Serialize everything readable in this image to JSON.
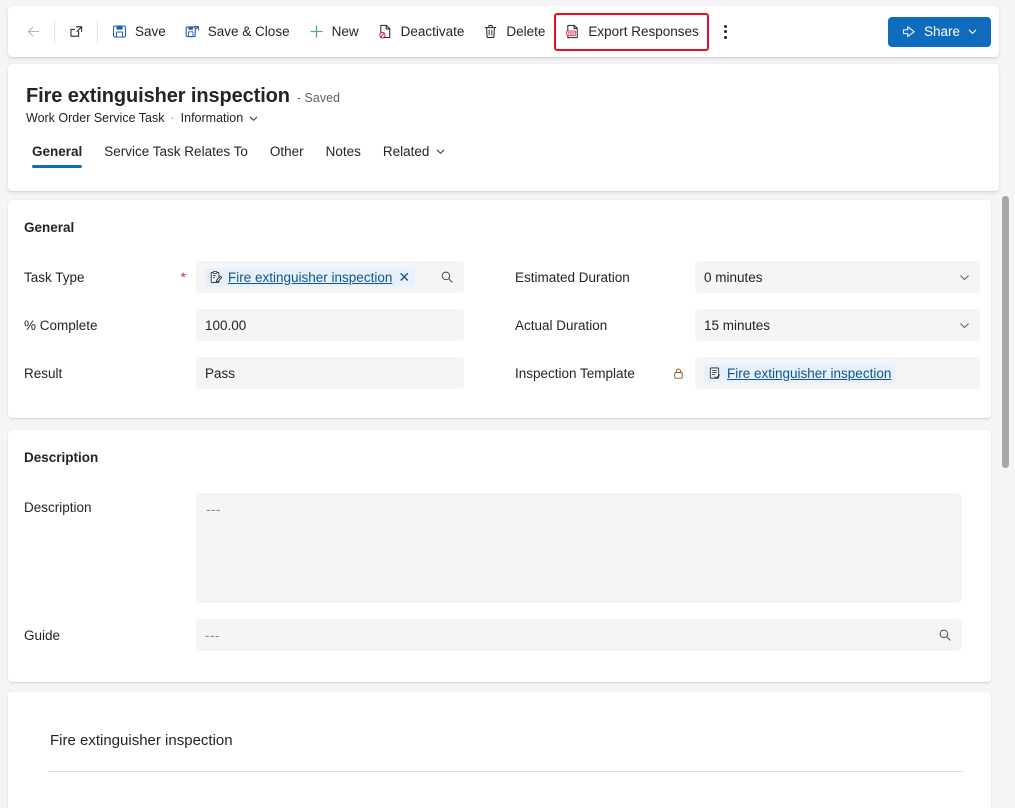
{
  "commandbar": {
    "back_label": "Back",
    "popout_label": "Open in new window",
    "buttons": [
      {
        "id": "save",
        "label": "Save",
        "icon": "save-icon"
      },
      {
        "id": "save-close",
        "label": "Save & Close",
        "icon": "save-and-close-icon"
      },
      {
        "id": "new",
        "label": "New",
        "icon": "plus-icon"
      },
      {
        "id": "deactivate",
        "label": "Deactivate",
        "icon": "deactivate-icon"
      },
      {
        "id": "delete",
        "label": "Delete",
        "icon": "trash-icon"
      },
      {
        "id": "export-responses",
        "label": "Export Responses",
        "icon": "pdf-icon",
        "highlighted": true
      }
    ],
    "overflow_label": "More commands",
    "share_label": "Share",
    "highlight_color": "#e81123",
    "accent_color": "#0f6cbd"
  },
  "record": {
    "title": "Fire extinguisher inspection",
    "saved_status": "- Saved",
    "entity": "Work Order Service Task",
    "separator": "·",
    "form_name": "Information"
  },
  "tabs": [
    {
      "label": "General",
      "active": true
    },
    {
      "label": "Service Task Relates To",
      "active": false
    },
    {
      "label": "Other",
      "active": false
    },
    {
      "label": "Notes",
      "active": false
    },
    {
      "label": "Related",
      "active": false,
      "has_chevron": true
    }
  ],
  "sections": {
    "general": {
      "title": "General",
      "left_fields": [
        {
          "label": "Task Type",
          "required": true,
          "type": "lookup",
          "value": "Fire extinguisher inspection",
          "icon": "task-type-icon",
          "clear_label": "✕",
          "search_label": "Search records"
        },
        {
          "label": "% Complete",
          "required": false,
          "type": "text",
          "value": "100.00"
        },
        {
          "label": "Result",
          "required": false,
          "type": "text",
          "value": "Pass"
        }
      ],
      "right_fields": [
        {
          "label": "Estimated Duration",
          "type": "dropdown",
          "value": "0 minutes"
        },
        {
          "label": "Actual Duration",
          "type": "dropdown",
          "value": "15 minutes"
        },
        {
          "label": "Inspection Template",
          "type": "locked-lookup",
          "value": "Fire extinguisher inspection",
          "icon": "inspection-template-icon",
          "locked": true
        }
      ]
    },
    "description": {
      "title": "Description",
      "description_label": "Description",
      "description_value": "---",
      "guide_label": "Guide",
      "guide_value": "---",
      "guide_search_label": "Search records"
    },
    "inspection": {
      "heading": "Fire extinguisher inspection"
    }
  },
  "scrollbar": {
    "vertical_position_label": "Vertical scrollbar"
  }
}
